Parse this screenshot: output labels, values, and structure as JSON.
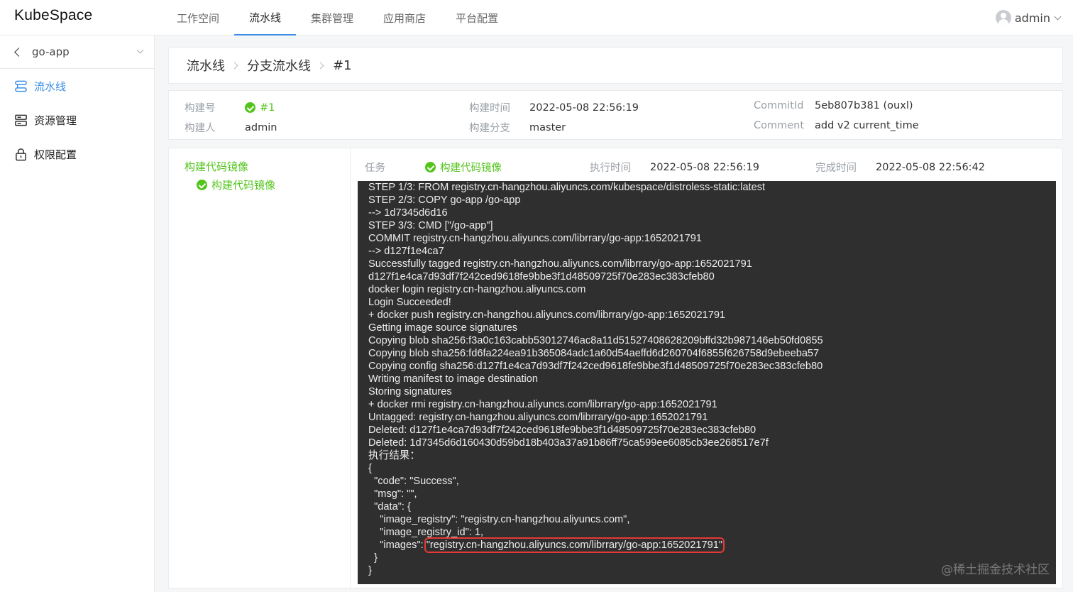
{
  "app": {
    "logo": "KubeSpace"
  },
  "topnav": [
    {
      "label": "工作空间",
      "active": false
    },
    {
      "label": "流水线",
      "active": true
    },
    {
      "label": "集群管理",
      "active": false
    },
    {
      "label": "应用商店",
      "active": false
    },
    {
      "label": "平台配置",
      "active": false
    }
  ],
  "user": {
    "name": "admin"
  },
  "sidebar": {
    "project": "go-app",
    "items": [
      {
        "label": "流水线",
        "icon": "pipeline-icon",
        "active": true
      },
      {
        "label": "资源管理",
        "icon": "server-icon",
        "active": false
      },
      {
        "label": "权限配置",
        "icon": "lock-icon",
        "active": false
      }
    ]
  },
  "breadcrumb": [
    "流水线",
    "分支流水线",
    "#1"
  ],
  "build_info": {
    "build_no_label": "构建号",
    "build_no": "#1",
    "builder_label": "构建人",
    "builder": "admin",
    "build_time_label": "构建时间",
    "build_time": "2022-05-08 22:56:19",
    "branch_label": "构建分支",
    "branch": "master",
    "commit_label": "CommitId",
    "commit": "5eb807b381 (ouxl)",
    "comment_label": "Comment",
    "comment": "add v2 current_time",
    "status_color": "#52c41a"
  },
  "stage": {
    "title": "构建代码镜像",
    "task": "构建代码镜像"
  },
  "job": {
    "task_label": "任务",
    "task": "构建代码镜像",
    "exec_label": "执行时间",
    "exec_time": "2022-05-08 22:56:19",
    "done_label": "完成时间",
    "done_time": "2022-05-08 22:56:42"
  },
  "log": {
    "lines": [
      "STEP 1/3: FROM registry.cn-hangzhou.aliyuncs.com/kubespace/distroless-static:latest",
      "STEP 2/3: COPY go-app /go-app",
      "--> 1d7345d6d16",
      "STEP 3/3: CMD [\"/go-app\"]",
      "COMMIT registry.cn-hangzhou.aliyuncs.com/librrary/go-app:1652021791",
      "--> d127f1e4ca7",
      "Successfully tagged registry.cn-hangzhou.aliyuncs.com/librrary/go-app:1652021791",
      "d127f1e4ca7d93df7f242ced9618fe9bbe3f1d48509725f70e283ec383cfeb80",
      "docker login registry.cn-hangzhou.aliyuncs.com",
      "Login Succeeded!",
      "+ docker push registry.cn-hangzhou.aliyuncs.com/librrary/go-app:1652021791",
      "Getting image source signatures",
      "Copying blob sha256:f3a0c163cabb53012746ac8a11d51527408628209bffd32b987146eb50fd0855",
      "Copying blob sha256:fd6fa224ea91b365084adc1a60d54aeffd6d260704f6855f626758d9ebeeba57",
      "Copying config sha256:d127f1e4ca7d93df7f242ced9618fe9bbe3f1d48509725f70e283ec383cfeb80",
      "Writing manifest to image destination",
      "Storing signatures",
      "+ docker rmi registry.cn-hangzhou.aliyuncs.com/librrary/go-app:1652021791",
      "Untagged: registry.cn-hangzhou.aliyuncs.com/librrary/go-app:1652021791",
      "Deleted: d127f1e4ca7d93df7f242ced9618fe9bbe3f1d48509725f70e283ec383cfeb80",
      "Deleted: 1d7345d6d160430d59bd18b403a37a91b86ff75ca599ee6085cb3ee268517e7f",
      "执行结果：",
      "{",
      "  \"code\": \"Success\",",
      "  \"msg\": \"\",",
      "  \"data\": {",
      "    \"image_registry\": \"registry.cn-hangzhou.aliyuncs.com\",",
      "    \"image_registry_id\": 1,",
      "    \"images\": ",
      "  }",
      "}"
    ],
    "highlight": "\"registry.cn-hangzhou.aliyuncs.com/librrary/go-app:1652021791\"",
    "highlight_line_index": 28,
    "highlight_color": "#e53935"
  },
  "watermark": "@稀土掘金技术社区"
}
